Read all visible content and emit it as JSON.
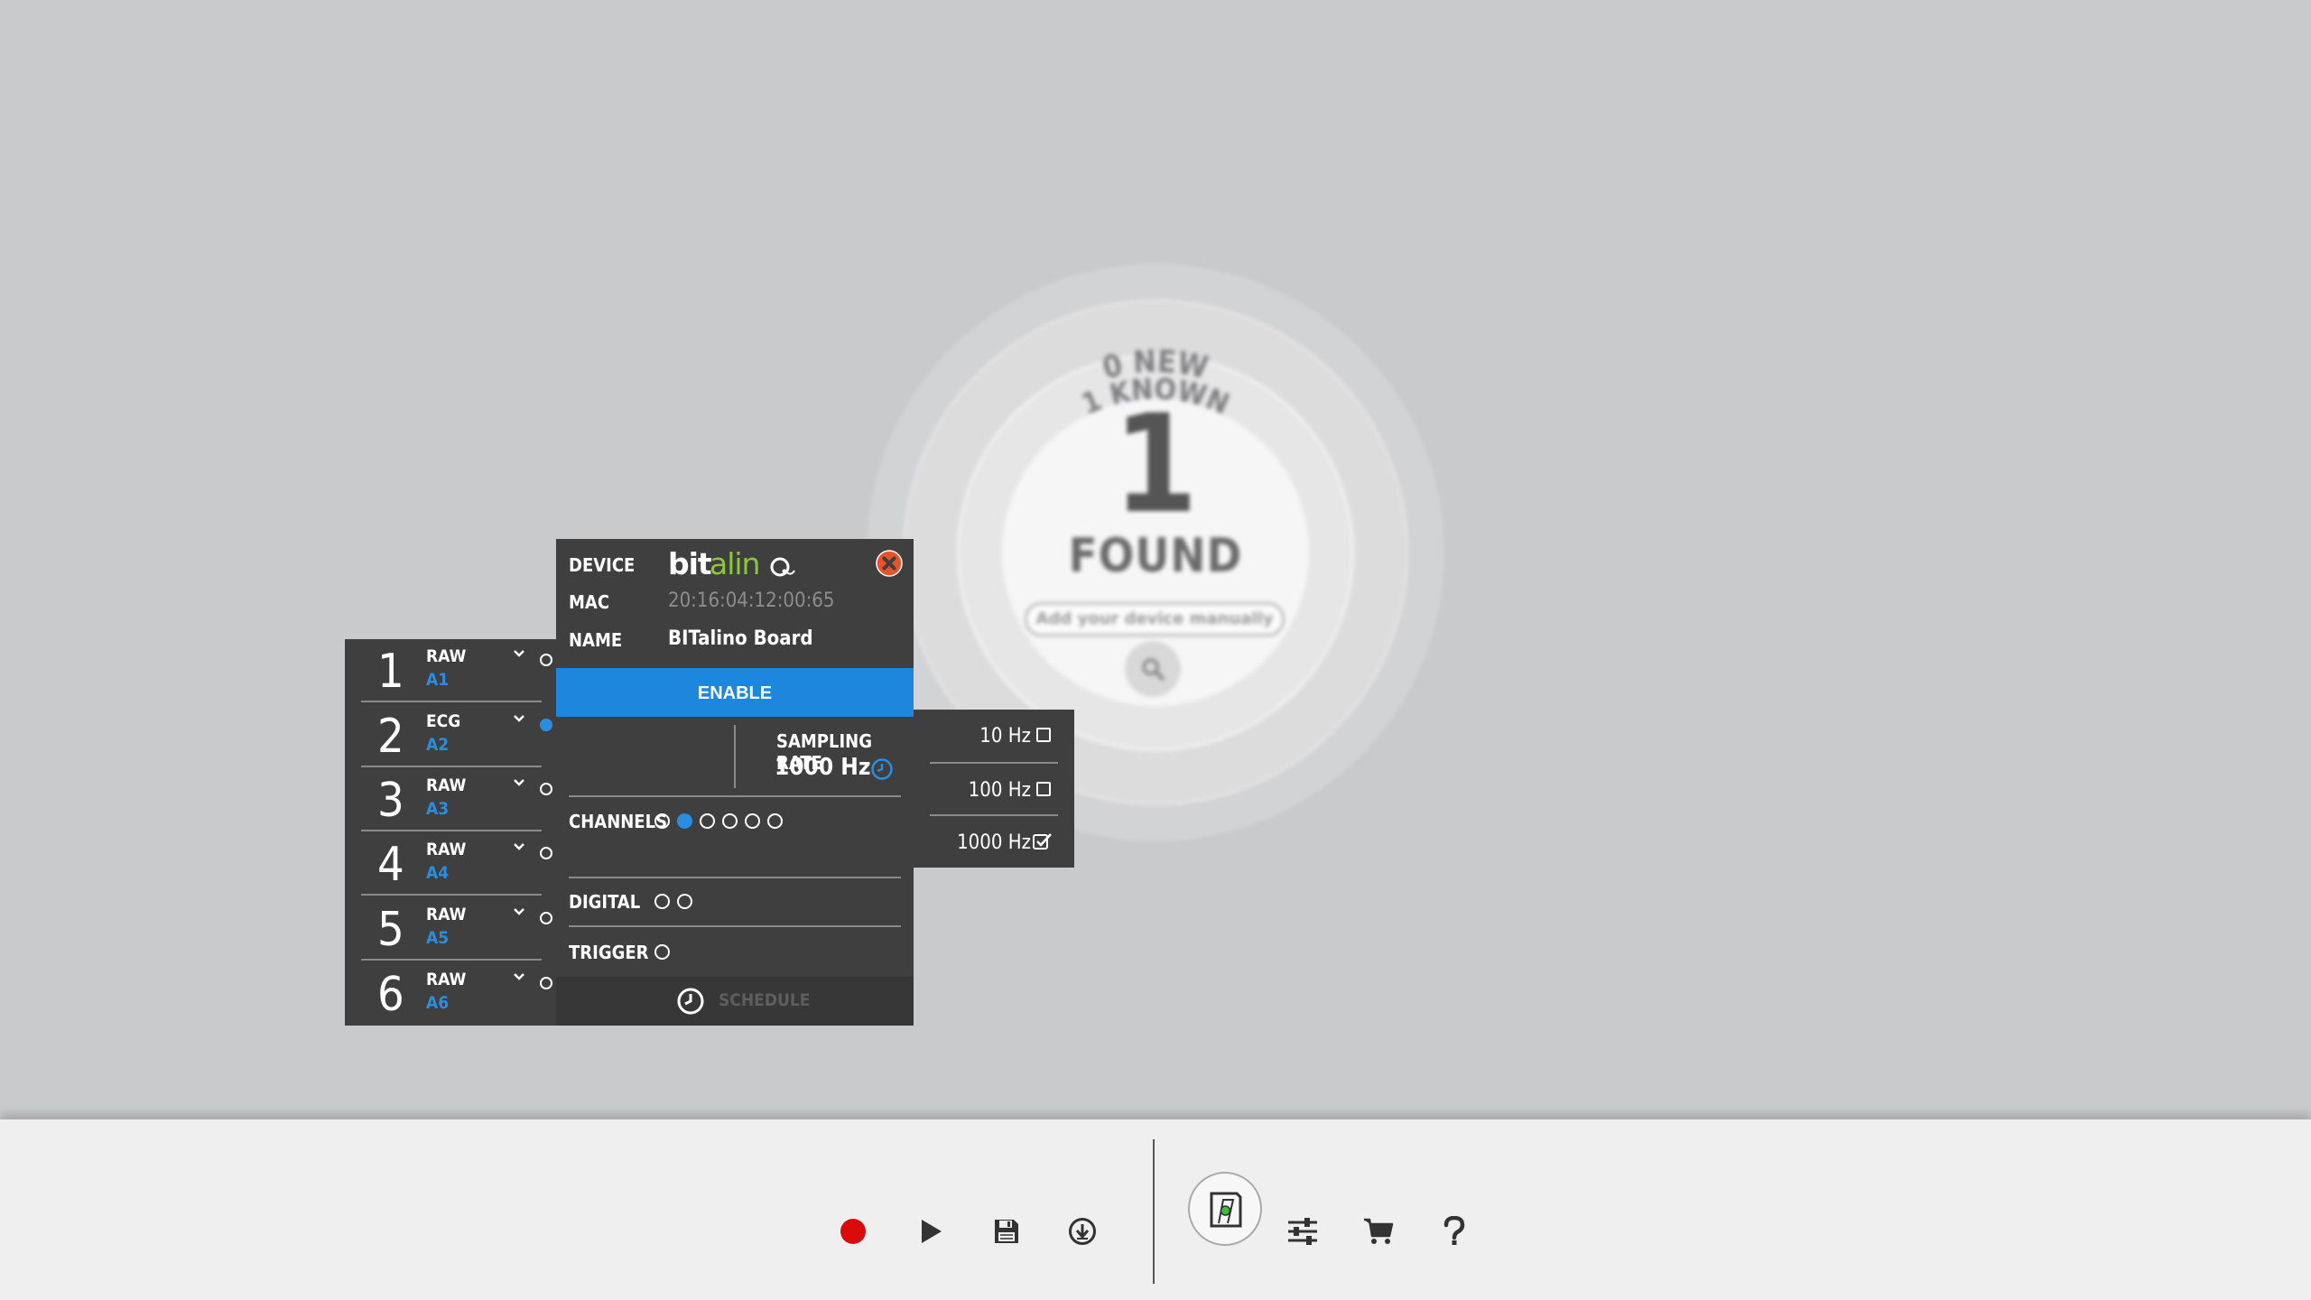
{
  "scanner": {
    "new_count": "0",
    "new_label": "NEW",
    "known_count": "1",
    "known_label": "KNOWN",
    "found_count": "1",
    "found_label": "FOUND",
    "manual_placeholder": "Add your device manually"
  },
  "channels": [
    {
      "number": "1",
      "type": "RAW",
      "port": "A1",
      "enabled": false
    },
    {
      "number": "2",
      "type": "ECG",
      "port": "A2",
      "enabled": true
    },
    {
      "number": "3",
      "type": "RAW",
      "port": "A3",
      "enabled": false
    },
    {
      "number": "4",
      "type": "RAW",
      "port": "A4",
      "enabled": false
    },
    {
      "number": "5",
      "type": "RAW",
      "port": "A5",
      "enabled": false
    },
    {
      "number": "6",
      "type": "RAW",
      "port": "A6",
      "enabled": false
    }
  ],
  "device": {
    "device_label": "DEVICE",
    "logo_text": "bitalino",
    "mac_label": "MAC",
    "mac_value": "20:16:04:12:00:65",
    "name_label": "NAME",
    "name_value": "BITalino Board",
    "enable_label": "ENABLE",
    "sampling_rate_label": "SAMPLING RATE",
    "sampling_rate_value": "1000 Hz",
    "channels_label": "CHANNELS",
    "digital_label": "DIGITAL",
    "trigger_label": "TRIGGER",
    "schedule_label": "SCHEDULE"
  },
  "sampling_options": [
    {
      "label": "10 Hz",
      "checked": false
    },
    {
      "label": "100 Hz",
      "checked": false
    },
    {
      "label": "1000 Hz",
      "checked": true
    }
  ],
  "colors": {
    "accent_blue": "#1c87dd",
    "record_red": "#d90b0b",
    "close_orange": "#e8542a",
    "logo_green": "#8cc63f"
  },
  "toolbar": {
    "icons": [
      "record-icon",
      "play-icon",
      "save-icon",
      "download-icon",
      "device-icon",
      "settings-icon",
      "cart-icon",
      "help-icon"
    ]
  }
}
